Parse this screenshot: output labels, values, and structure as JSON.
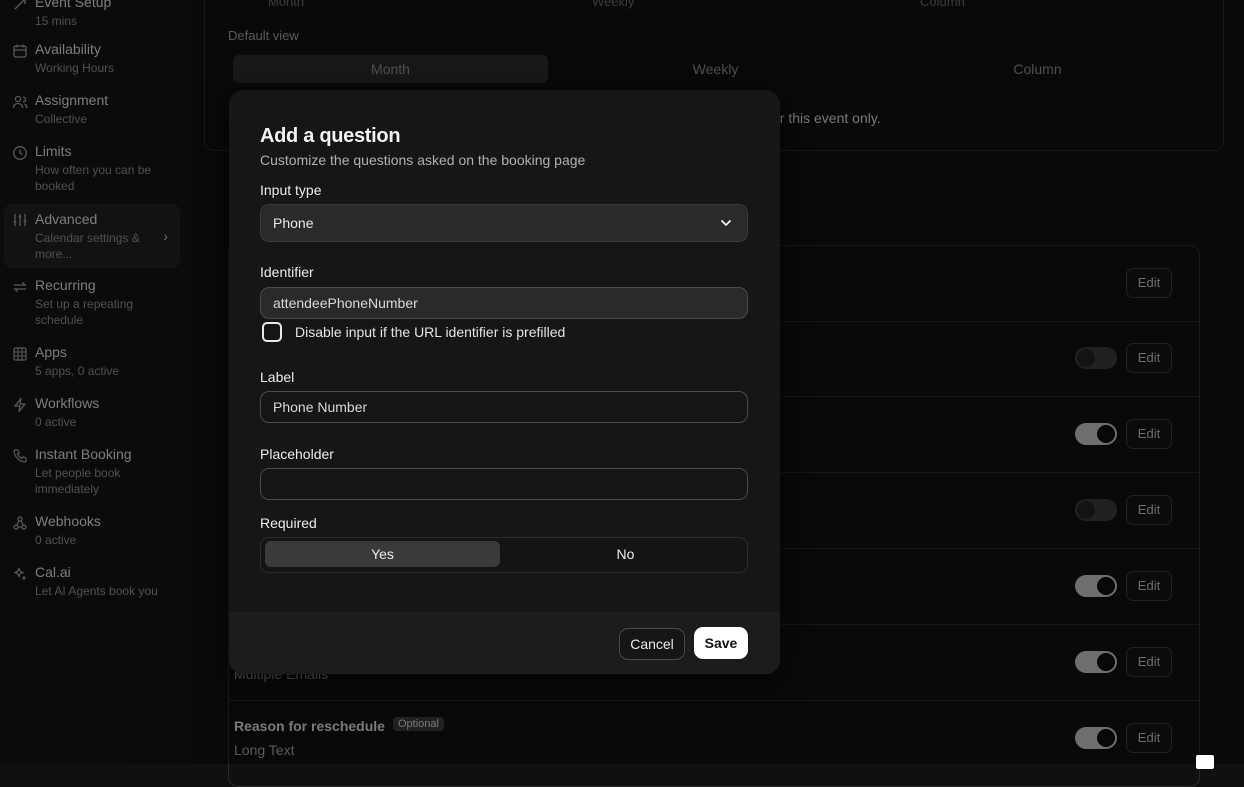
{
  "sidebar": {
    "items": [
      {
        "title": "Event Setup",
        "sub": "15 mins",
        "icon": "link-icon"
      },
      {
        "title": "Availability",
        "sub": "Working Hours",
        "icon": "calendar-icon"
      },
      {
        "title": "Assignment",
        "sub": "Collective",
        "icon": "users-icon"
      },
      {
        "title": "Limits",
        "sub": "How often you can be booked",
        "icon": "clock-icon"
      },
      {
        "title": "Advanced",
        "sub": "Calendar settings & more...",
        "icon": "sliders-icon"
      },
      {
        "title": "Recurring",
        "sub": "Set up a repeating schedule",
        "icon": "repeat-icon"
      },
      {
        "title": "Apps",
        "sub": "5 apps, 0 active",
        "icon": "grid-icon"
      },
      {
        "title": "Workflows",
        "sub": "0 active",
        "icon": "zap-icon"
      },
      {
        "title": "Instant Booking",
        "sub": "Let people book immediately",
        "icon": "phone-call-icon"
      },
      {
        "title": "Webhooks",
        "sub": "0 active",
        "icon": "webhook-icon"
      },
      {
        "title": "Cal.ai",
        "sub": "Let AI Agents book you",
        "icon": "sparkles-icon"
      }
    ]
  },
  "background": {
    "top_row": [
      "Month",
      "Weekly",
      "Column"
    ],
    "default_view_label": "Default view",
    "view_tabs": [
      "Month",
      "Weekly",
      "Column"
    ],
    "partial_text": "or this event only.",
    "edit_label": "Edit",
    "rows": [
      {
        "title": "",
        "sub": "Multiple Emails"
      },
      {
        "title": "Reason for reschedule",
        "badge": "Optional",
        "sub": "Long Text"
      }
    ]
  },
  "modal": {
    "title": "Add a question",
    "subtitle": "Customize the questions asked on the booking page",
    "input_type_label": "Input type",
    "input_type_value": "Phone",
    "identifier_label": "Identifier",
    "identifier_value": "attendeePhoneNumber",
    "disable_checkbox_label": "Disable input if the URL identifier is prefilled",
    "label_label": "Label",
    "label_value": "Phone Number",
    "placeholder_label": "Placeholder",
    "placeholder_value": "",
    "required_label": "Required",
    "required_options": [
      "Yes",
      "No"
    ],
    "cancel_label": "Cancel",
    "save_label": "Save"
  }
}
